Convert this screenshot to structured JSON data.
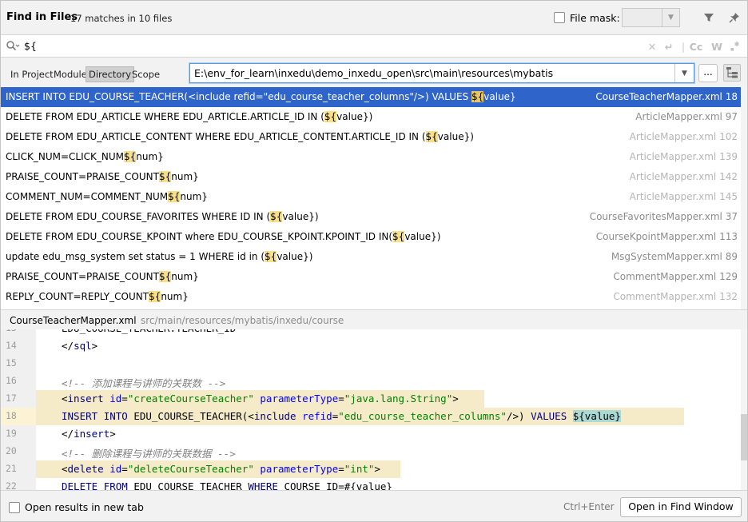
{
  "header": {
    "title": "Find in Files",
    "matches": "17 matches in 10 files",
    "file_mask_label": "File mask:",
    "file_mask_checked": false
  },
  "search": {
    "query": "${",
    "toggles": [
      "Cc",
      "W"
    ]
  },
  "scope": {
    "options": [
      "In Project",
      "Module",
      "Directory",
      "Scope"
    ],
    "selected": "Directory",
    "directory": "E:\\env_for_learn\\inxedu\\demo_inxedu_open\\src\\main\\resources\\mybatis",
    "browse_label": "..."
  },
  "results": [
    {
      "pre": "INSERT INTO EDU_COURSE_TEACHER(<include refid=\"edu_course_teacher_columns\"/>) VALUES ",
      "match": "${",
      "post": "value}",
      "file": "CourseTeacherMapper.xml",
      "line": "18",
      "selected": true
    },
    {
      "pre": "DELETE FROM EDU_ARTICLE WHERE EDU_ARTICLE.ARTICLE_ID IN (",
      "match": "${",
      "post": "value})",
      "file": "ArticleMapper.xml",
      "line": "97"
    },
    {
      "pre": "DELETE FROM EDU_ARTICLE_CONTENT WHERE EDU_ARTICLE_CONTENT.ARTICLE_ID IN (",
      "match": "${",
      "post": "value})",
      "file": "ArticleMapper.xml",
      "line": "102",
      "faded": true
    },
    {
      "pre": "CLICK_NUM=CLICK_NUM",
      "match": "${",
      "post": "num}",
      "file": "ArticleMapper.xml",
      "line": "139",
      "faded": true
    },
    {
      "pre": "PRAISE_COUNT=PRAISE_COUNT",
      "match": "${",
      "post": "num}",
      "file": "ArticleMapper.xml",
      "line": "142",
      "faded": true
    },
    {
      "pre": "COMMENT_NUM=COMMENT_NUM",
      "match": "${",
      "post": "num}",
      "file": "ArticleMapper.xml",
      "line": "145",
      "faded": true
    },
    {
      "pre": "DELETE FROM EDU_COURSE_FAVORITES WHERE ID  IN  (",
      "match": "${",
      "post": "value})",
      "file": "CourseFavoritesMapper.xml",
      "line": "37"
    },
    {
      "pre": "DELETE FROM EDU_COURSE_KPOINT where EDU_COURSE_KPOINT.KPOINT_ID IN(",
      "match": "${",
      "post": "value})",
      "file": "CourseKpointMapper.xml",
      "line": "113"
    },
    {
      "pre": "update  edu_msg_system set status = 1 WHERE id in (",
      "match": "${",
      "post": "value})",
      "file": "MsgSystemMapper.xml",
      "line": "89"
    },
    {
      "pre": "PRAISE_COUNT=PRAISE_COUNT",
      "match": "${",
      "post": "num}",
      "file": "CommentMapper.xml",
      "line": "129"
    },
    {
      "pre": "REPLY_COUNT=REPLY_COUNT",
      "match": "${",
      "post": "num}",
      "file": "CommentMapper.xml",
      "line": "132",
      "faded": true
    }
  ],
  "preview": {
    "file": "CourseTeacherMapper.xml",
    "path": "src/main/resources/mybatis/inxedu/course",
    "lines": [
      {
        "n": "13",
        "text": "EDU_COURSE_TEACHER.TEACHER_ID"
      },
      {
        "n": "14",
        "text": "</sql>"
      },
      {
        "n": "15",
        "text": ""
      },
      {
        "n": "16",
        "text": "<!-- 添加课程与讲师的关联数 -->"
      },
      {
        "n": "17",
        "text": "<insert id=\"createCourseTeacher\" parameterType=\"java.lang.String\">"
      },
      {
        "n": "18",
        "text": "INSERT INTO EDU_COURSE_TEACHER(<include refid=\"edu_course_teacher_columns\"/>) VALUES ${value}"
      },
      {
        "n": "19",
        "text": "</insert>"
      },
      {
        "n": "20",
        "text": "<!-- 删除课程与讲师的关联数据 -->"
      },
      {
        "n": "21",
        "text": "<delete id=\"deleteCourseTeacher\" parameterType=\"int\">"
      },
      {
        "n": "22",
        "text": "DELETE FROM EDU_COURSE_TEACHER WHERE COURSE_ID=#{value}"
      }
    ]
  },
  "footer": {
    "open_new_tab_label": "Open results in new tab",
    "open_new_tab_checked": false,
    "shortcut": "Ctrl+Enter",
    "open_button": "Open in Find Window"
  }
}
